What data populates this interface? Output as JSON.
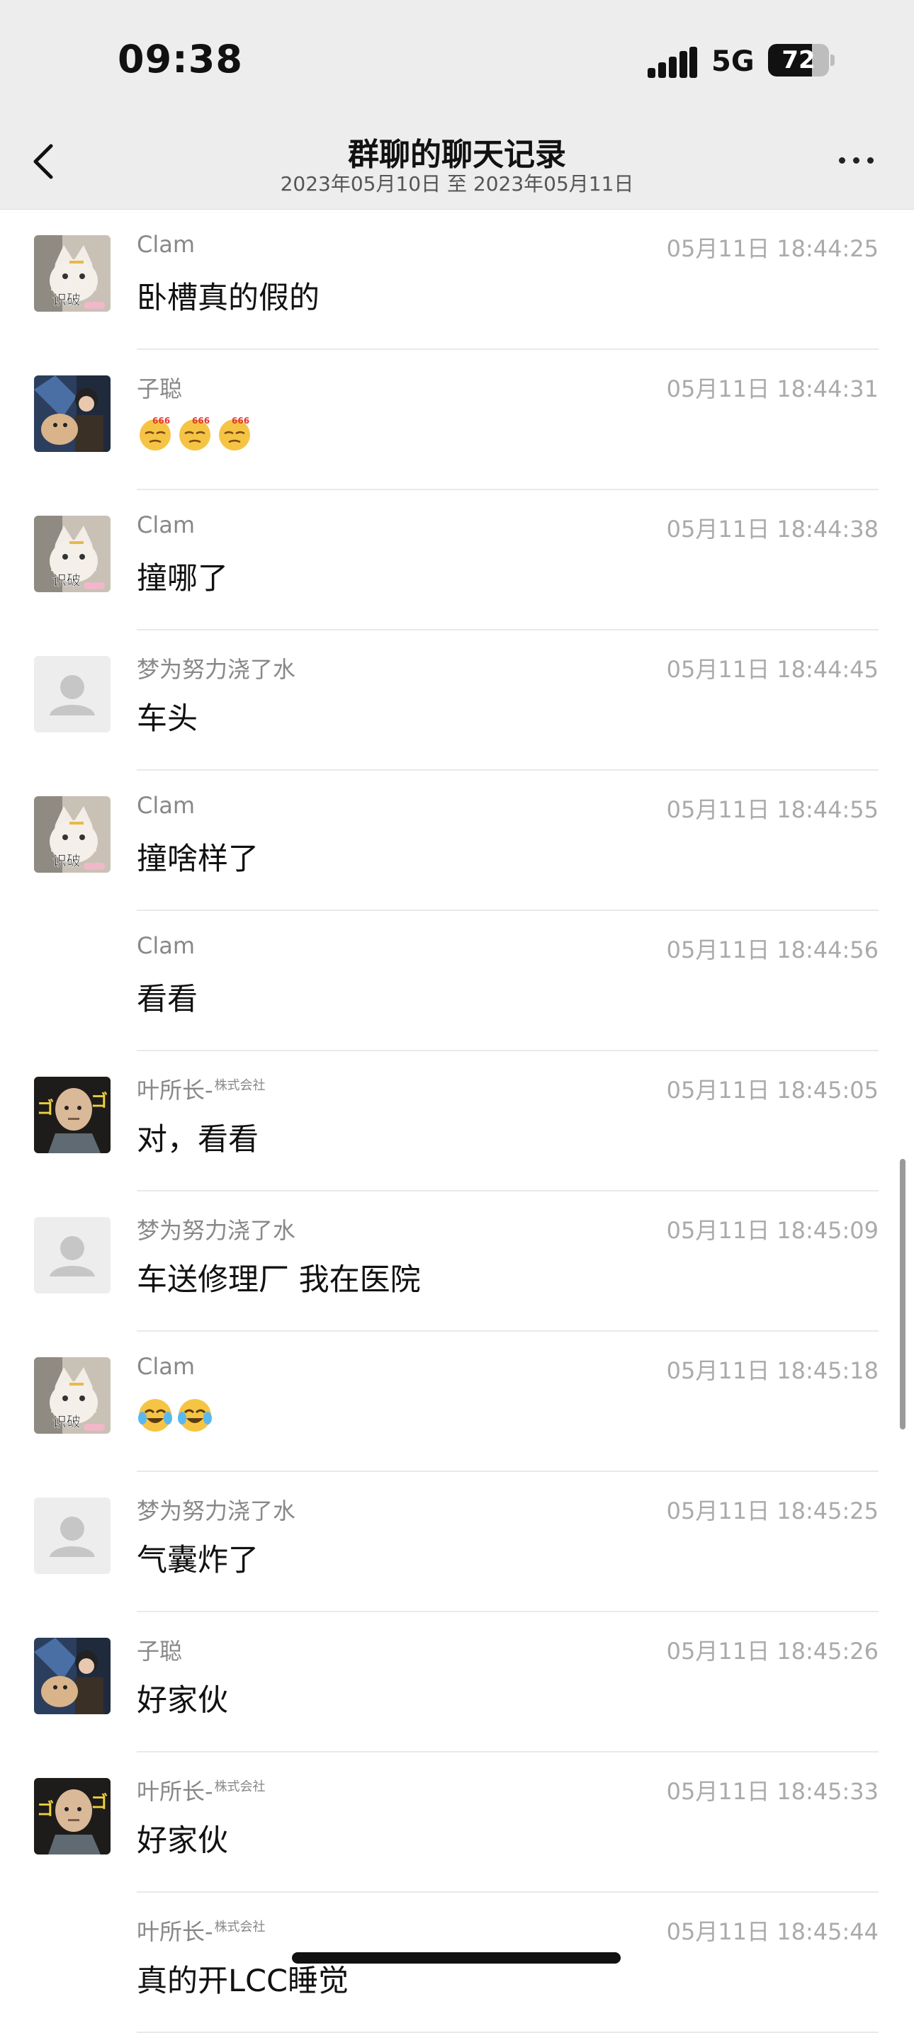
{
  "status_bar": {
    "time": "09:38",
    "network": "5G",
    "battery": "72",
    "battery_level": 0.72
  },
  "nav": {
    "title": "群聊的聊天记录",
    "subtitle": "2023年05月10日 至 2023年05月11日"
  },
  "messages": [
    {
      "sender": "Clam",
      "time": "05月11日 18:44:25",
      "text": "卧槽真的假的",
      "avatar": "cat-avatar"
    },
    {
      "sender": "子聪",
      "time": "05月11日 18:44:31",
      "text": "",
      "emojis": [
        "666-emoji",
        "666-emoji",
        "666-emoji"
      ],
      "avatar": "dog-person-avatar"
    },
    {
      "sender": "Clam",
      "time": "05月11日 18:44:38",
      "text": "撞哪了",
      "avatar": "cat-avatar"
    },
    {
      "sender": "梦为努力浇了水",
      "time": "05月11日 18:44:45",
      "text": "车头",
      "avatar": "default-avatar"
    },
    {
      "sender": "Clam",
      "time": "05月11日 18:44:55",
      "text": "撞啥样了",
      "avatar": "cat-avatar"
    },
    {
      "sender": "Clam",
      "time": "05月11日 18:44:56",
      "text": "看看",
      "avatar": "none"
    },
    {
      "sender": "叶所长-",
      "sender_badge": "株式会社",
      "time": "05月11日 18:45:05",
      "text": "对，看看",
      "avatar": "bald-man-avatar"
    },
    {
      "sender": "梦为努力浇了水",
      "time": "05月11日 18:45:09",
      "text": "车送修理厂 我在医院",
      "avatar": "default-avatar"
    },
    {
      "sender": "Clam",
      "time": "05月11日 18:45:18",
      "text": "",
      "emojis": [
        "laugh-cry-emoji",
        "laugh-cry-emoji"
      ],
      "avatar": "cat-avatar"
    },
    {
      "sender": "梦为努力浇了水",
      "time": "05月11日 18:45:25",
      "text": "气囊炸了",
      "avatar": "default-avatar"
    },
    {
      "sender": "子聪",
      "time": "05月11日 18:45:26",
      "text": "好家伙",
      "avatar": "dog-person-avatar"
    },
    {
      "sender": "叶所长-",
      "sender_badge": "株式会社",
      "time": "05月11日 18:45:33",
      "text": "好家伙",
      "avatar": "bald-man-avatar"
    },
    {
      "sender": "叶所长-",
      "sender_badge": "株式会社",
      "time": "05月11日 18:45:44",
      "text": "真的开LCC睡觉",
      "avatar": "none"
    }
  ],
  "avatar_captions": {
    "cat": "识破"
  }
}
